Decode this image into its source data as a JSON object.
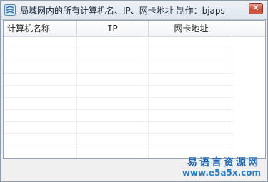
{
  "window": {
    "title": "局域网内的所有计算机名、IP、网卡地址   制作：bjaps",
    "close_glyph": "✕"
  },
  "listview": {
    "columns": [
      "计算机名称",
      "IP",
      "网卡地址",
      ""
    ],
    "rows": []
  },
  "watermark": {
    "site_name": "易语言资源网",
    "url": "www.e5a5x.com"
  }
}
